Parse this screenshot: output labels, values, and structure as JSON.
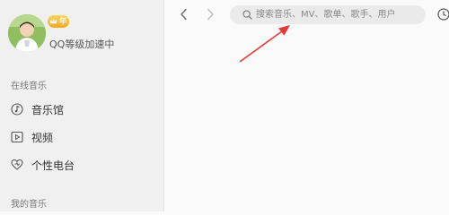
{
  "user": {
    "vip_badge_text": "年",
    "level_text": "QQ等级加速中"
  },
  "sidebar": {
    "online_music_title": "在线音乐",
    "items": [
      {
        "label": "音乐馆",
        "icon": "music-hall-icon"
      },
      {
        "label": "视频",
        "icon": "video-icon"
      },
      {
        "label": "个性电台",
        "icon": "radio-icon"
      }
    ],
    "my_music_title": "我的音乐"
  },
  "topbar": {
    "back_icon": "chevron-left-icon",
    "forward_icon": "chevron-right-icon",
    "search_placeholder": "搜索音乐、MV、歌单、歌手、用户",
    "search_value": "",
    "history_icon": "clock-icon"
  },
  "colors": {
    "annotation_arrow": "#e53935",
    "vip_gold": "#f7a91b",
    "sidebar_bg": "#f0f0f0"
  }
}
